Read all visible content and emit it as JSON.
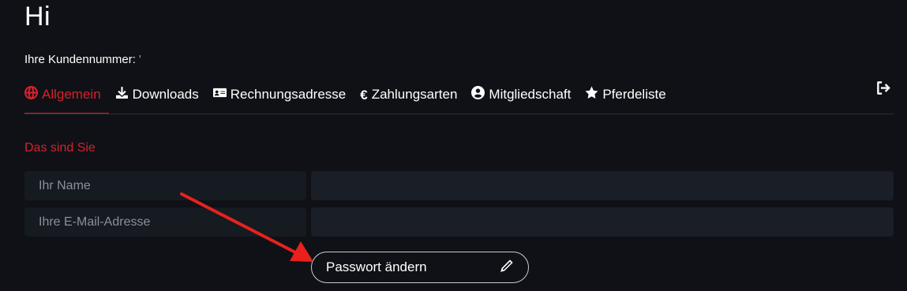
{
  "header": {
    "greeting": "Hi",
    "customer_label": "Ihre Kundennummer:",
    "customer_number": "'"
  },
  "tabs": [
    {
      "label": "Allgemein",
      "icon": "globe-icon",
      "active": true
    },
    {
      "label": "Downloads",
      "icon": "download-icon",
      "active": false
    },
    {
      "label": "Rechnungsadresse",
      "icon": "address-card-icon",
      "active": false
    },
    {
      "label": "Zahlungsarten",
      "icon": "euro-icon",
      "active": false
    },
    {
      "label": "Mitgliedschaft",
      "icon": "user-circle-icon",
      "active": false
    },
    {
      "label": "Pferdeliste",
      "icon": "star-icon",
      "active": false
    }
  ],
  "logout": {
    "icon": "sign-out-icon"
  },
  "section": {
    "title": "Das sind Sie"
  },
  "form": {
    "name_label": "Ihr Name",
    "name_value": "",
    "email_label": "Ihre E-Mail-Adresse",
    "email_value": ""
  },
  "password_button": {
    "label": "Passwort ändern",
    "icon": "pencil-icon"
  },
  "annotation": {
    "arrow_color": "#e8211d"
  },
  "colors": {
    "accent": "#d6212a",
    "background": "#0f1116"
  }
}
